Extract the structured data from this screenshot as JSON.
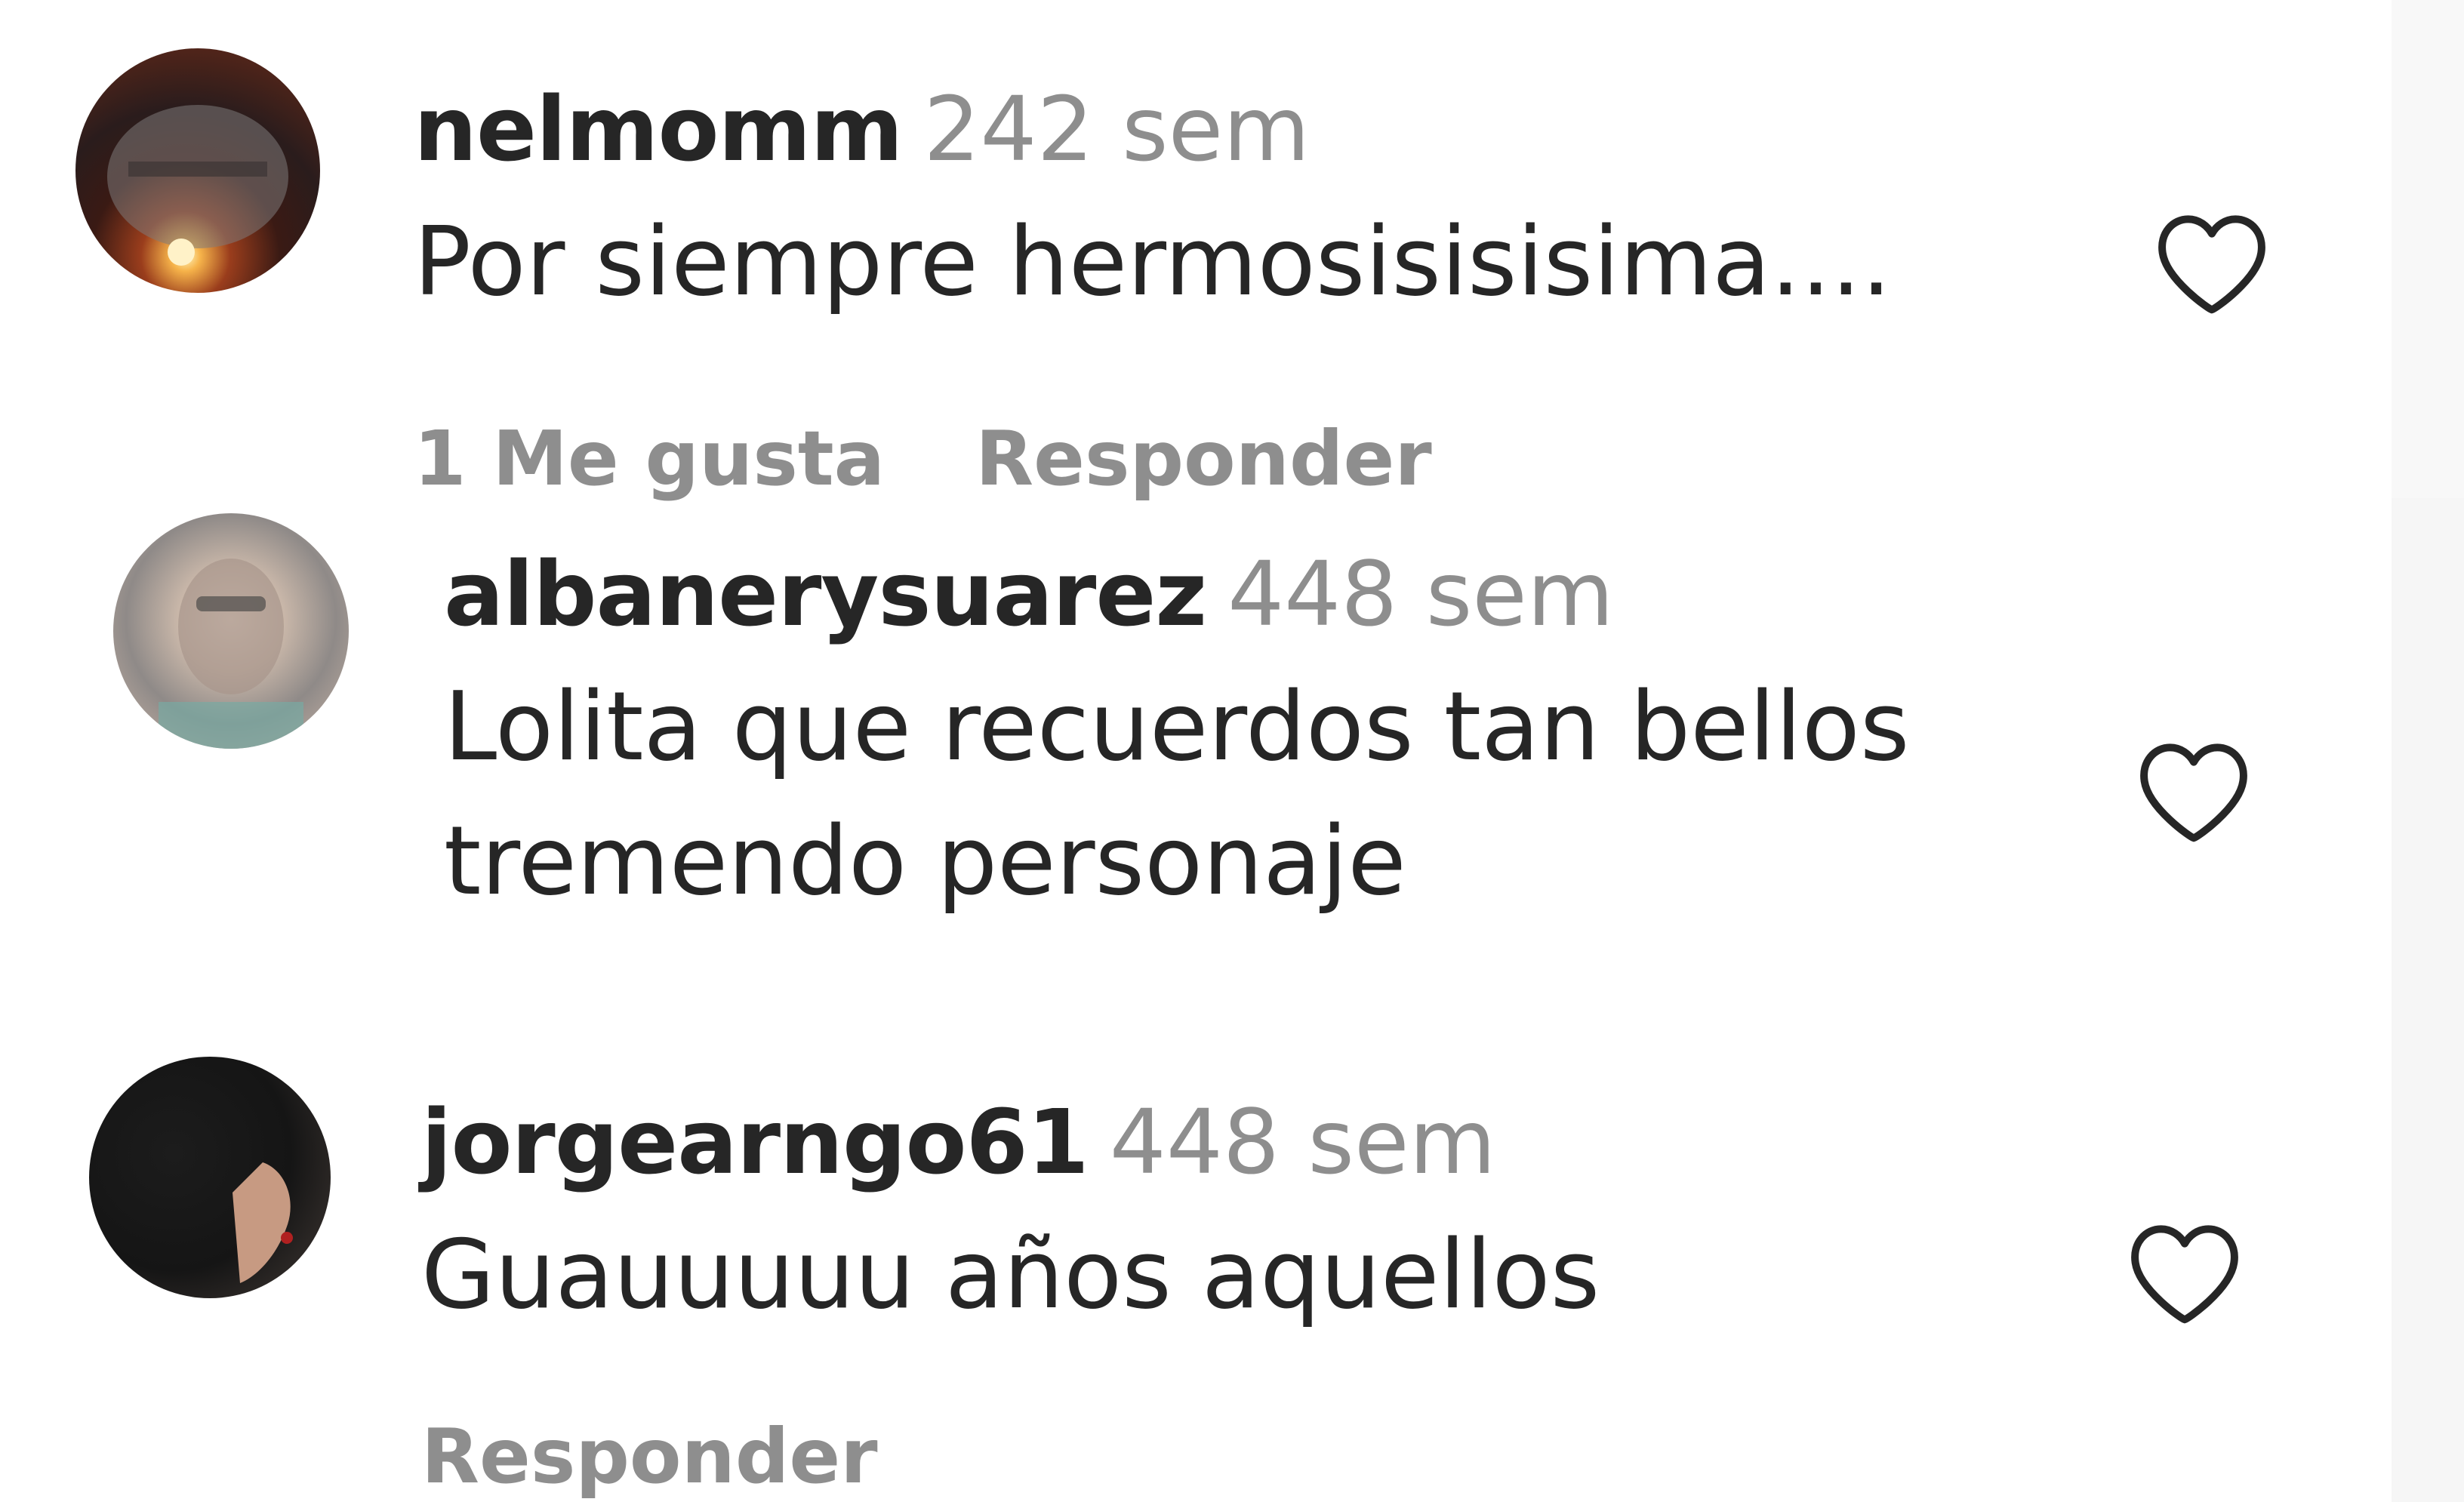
{
  "comments": [
    {
      "username": "nelmomm",
      "time": "242 sem",
      "text_lines": [
        "Por siempre hermosisisisima...."
      ],
      "likes": "1 Me gusta",
      "reply": "Responder",
      "like_icon": "heart-outline-icon"
    },
    {
      "username": "albanerysuarez",
      "time": "448 sem",
      "text_lines": [
        "Lolita que recuerdos tan bellos",
        "tremendo personaje"
      ],
      "like_icon": "heart-outline-icon"
    },
    {
      "username": "jorgearngo61",
      "time": "448 sem",
      "text_lines": [
        "Guauuuuu años aquellos"
      ],
      "reply": "Responder",
      "like_icon": "heart-outline-icon"
    }
  ],
  "colors": {
    "username": "#262626",
    "secondary": "#8e8e8e",
    "text": "#262626"
  }
}
